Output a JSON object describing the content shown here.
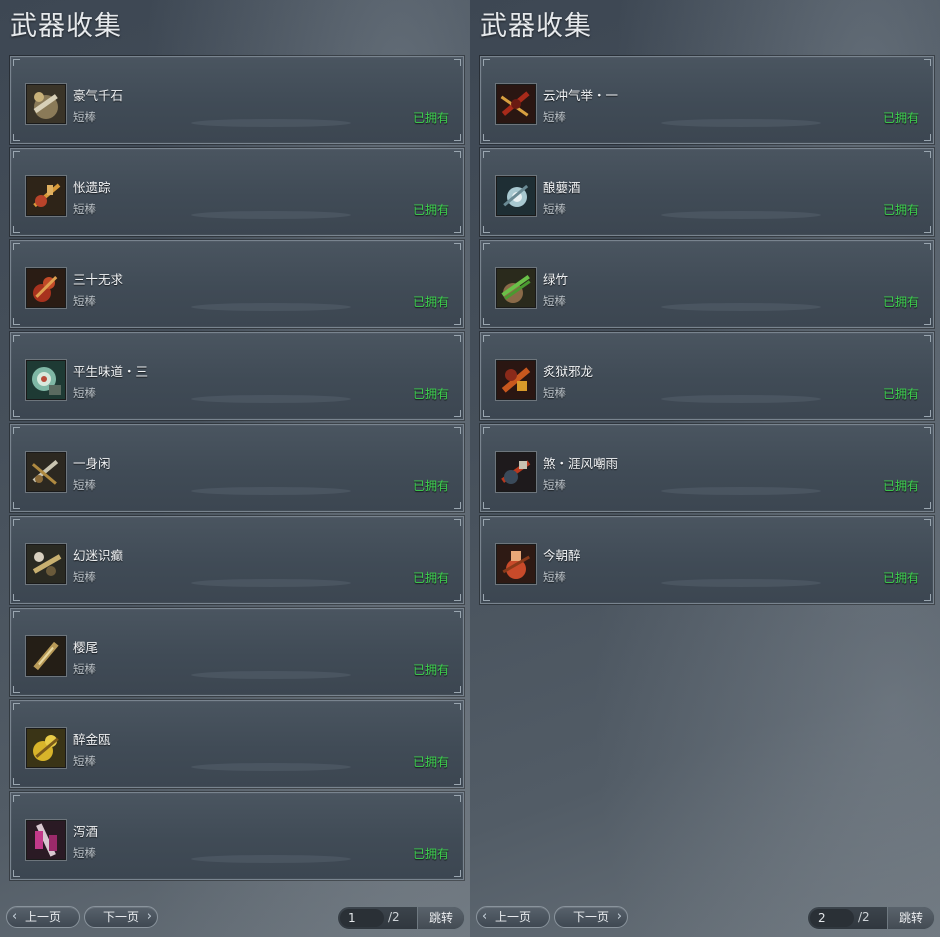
{
  "panels": [
    {
      "title": "武器收集",
      "items": [
        {
          "name": "豪气千石",
          "type": "短棒",
          "status": "已拥有",
          "icon": "axe-weapon-icon"
        },
        {
          "name": "怅遗踪",
          "type": "短棒",
          "status": "已拥有",
          "icon": "staff-weapon-icon"
        },
        {
          "name": "三十无求",
          "type": "短棒",
          "status": "已拥有",
          "icon": "gourd-weapon-icon"
        },
        {
          "name": "平生味道・三",
          "type": "短棒",
          "status": "已拥有",
          "icon": "disc-weapon-icon"
        },
        {
          "name": "一身闲",
          "type": "短棒",
          "status": "已拥有",
          "icon": "tool-weapon-icon"
        },
        {
          "name": "幻迷识癫",
          "type": "短棒",
          "status": "已拥有",
          "icon": "ornate-weapon-icon"
        },
        {
          "name": "樱尾",
          "type": "短棒",
          "status": "已拥有",
          "icon": "blade-weapon-icon"
        },
        {
          "name": "醉金瓯",
          "type": "短棒",
          "status": "已拥有",
          "icon": "golden-weapon-icon"
        },
        {
          "name": "泻酒",
          "type": "短棒",
          "status": "已拥有",
          "icon": "wine-staff-icon"
        }
      ],
      "prev_label": "上一页",
      "next_label": "下一页",
      "page": "1",
      "total": "/2",
      "jump_label": "跳转"
    },
    {
      "title": "武器收集",
      "items": [
        {
          "name": "云冲气举・一",
          "type": "短棒",
          "status": "已拥有",
          "icon": "red-staff-icon"
        },
        {
          "name": "酿蘡酒",
          "type": "短棒",
          "status": "已拥有",
          "icon": "silver-weapon-icon"
        },
        {
          "name": "绿竹",
          "type": "短棒",
          "status": "已拥有",
          "icon": "bamboo-weapon-icon"
        },
        {
          "name": "炙狱邪龙",
          "type": "短棒",
          "status": "已拥有",
          "icon": "dragon-weapon-icon"
        },
        {
          "name": "煞・涯风嘲雨",
          "type": "短棒",
          "status": "已拥有",
          "icon": "dark-weapon-icon"
        },
        {
          "name": "今朝醉",
          "type": "短棒",
          "status": "已拥有",
          "icon": "wine-gourd-icon"
        }
      ],
      "prev_label": "上一页",
      "next_label": "下一页",
      "page": "2",
      "total": "/2",
      "jump_label": "跳转"
    }
  ],
  "colors": {
    "status_owned": "#3ed24f",
    "card_border": "#79848f"
  }
}
